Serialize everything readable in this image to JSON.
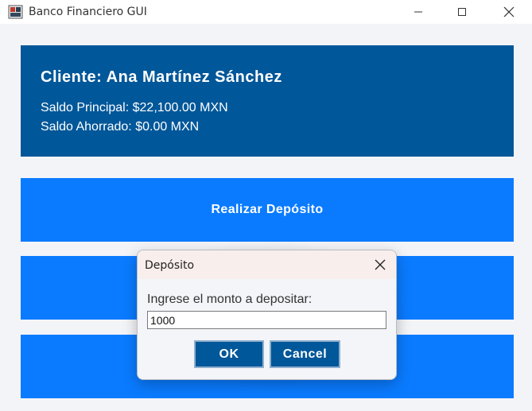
{
  "window": {
    "title": "Banco Financiero GUI",
    "icons": {
      "app": "bank-app-icon",
      "minimize": "minimize-icon",
      "maximize": "maximize-icon",
      "close": "close-icon"
    }
  },
  "client": {
    "name_line": "Cliente: Ana Martínez Sánchez",
    "balance_main": "Saldo Principal: $22,100.00 MXN",
    "balance_savings": "Saldo Ahorrado: $0.00 MXN"
  },
  "actions": {
    "deposit_label": "Realizar Depósito"
  },
  "dialog": {
    "title": "Depósito",
    "prompt": "Ingrese el monto a depositar:",
    "amount_value": "1000",
    "ok_label": "OK",
    "cancel_label": "Cancel"
  },
  "colors": {
    "client_panel": "#005799",
    "action_button": "#0a7bff",
    "dialog_button": "#005799",
    "background": "#f3f4f8"
  }
}
